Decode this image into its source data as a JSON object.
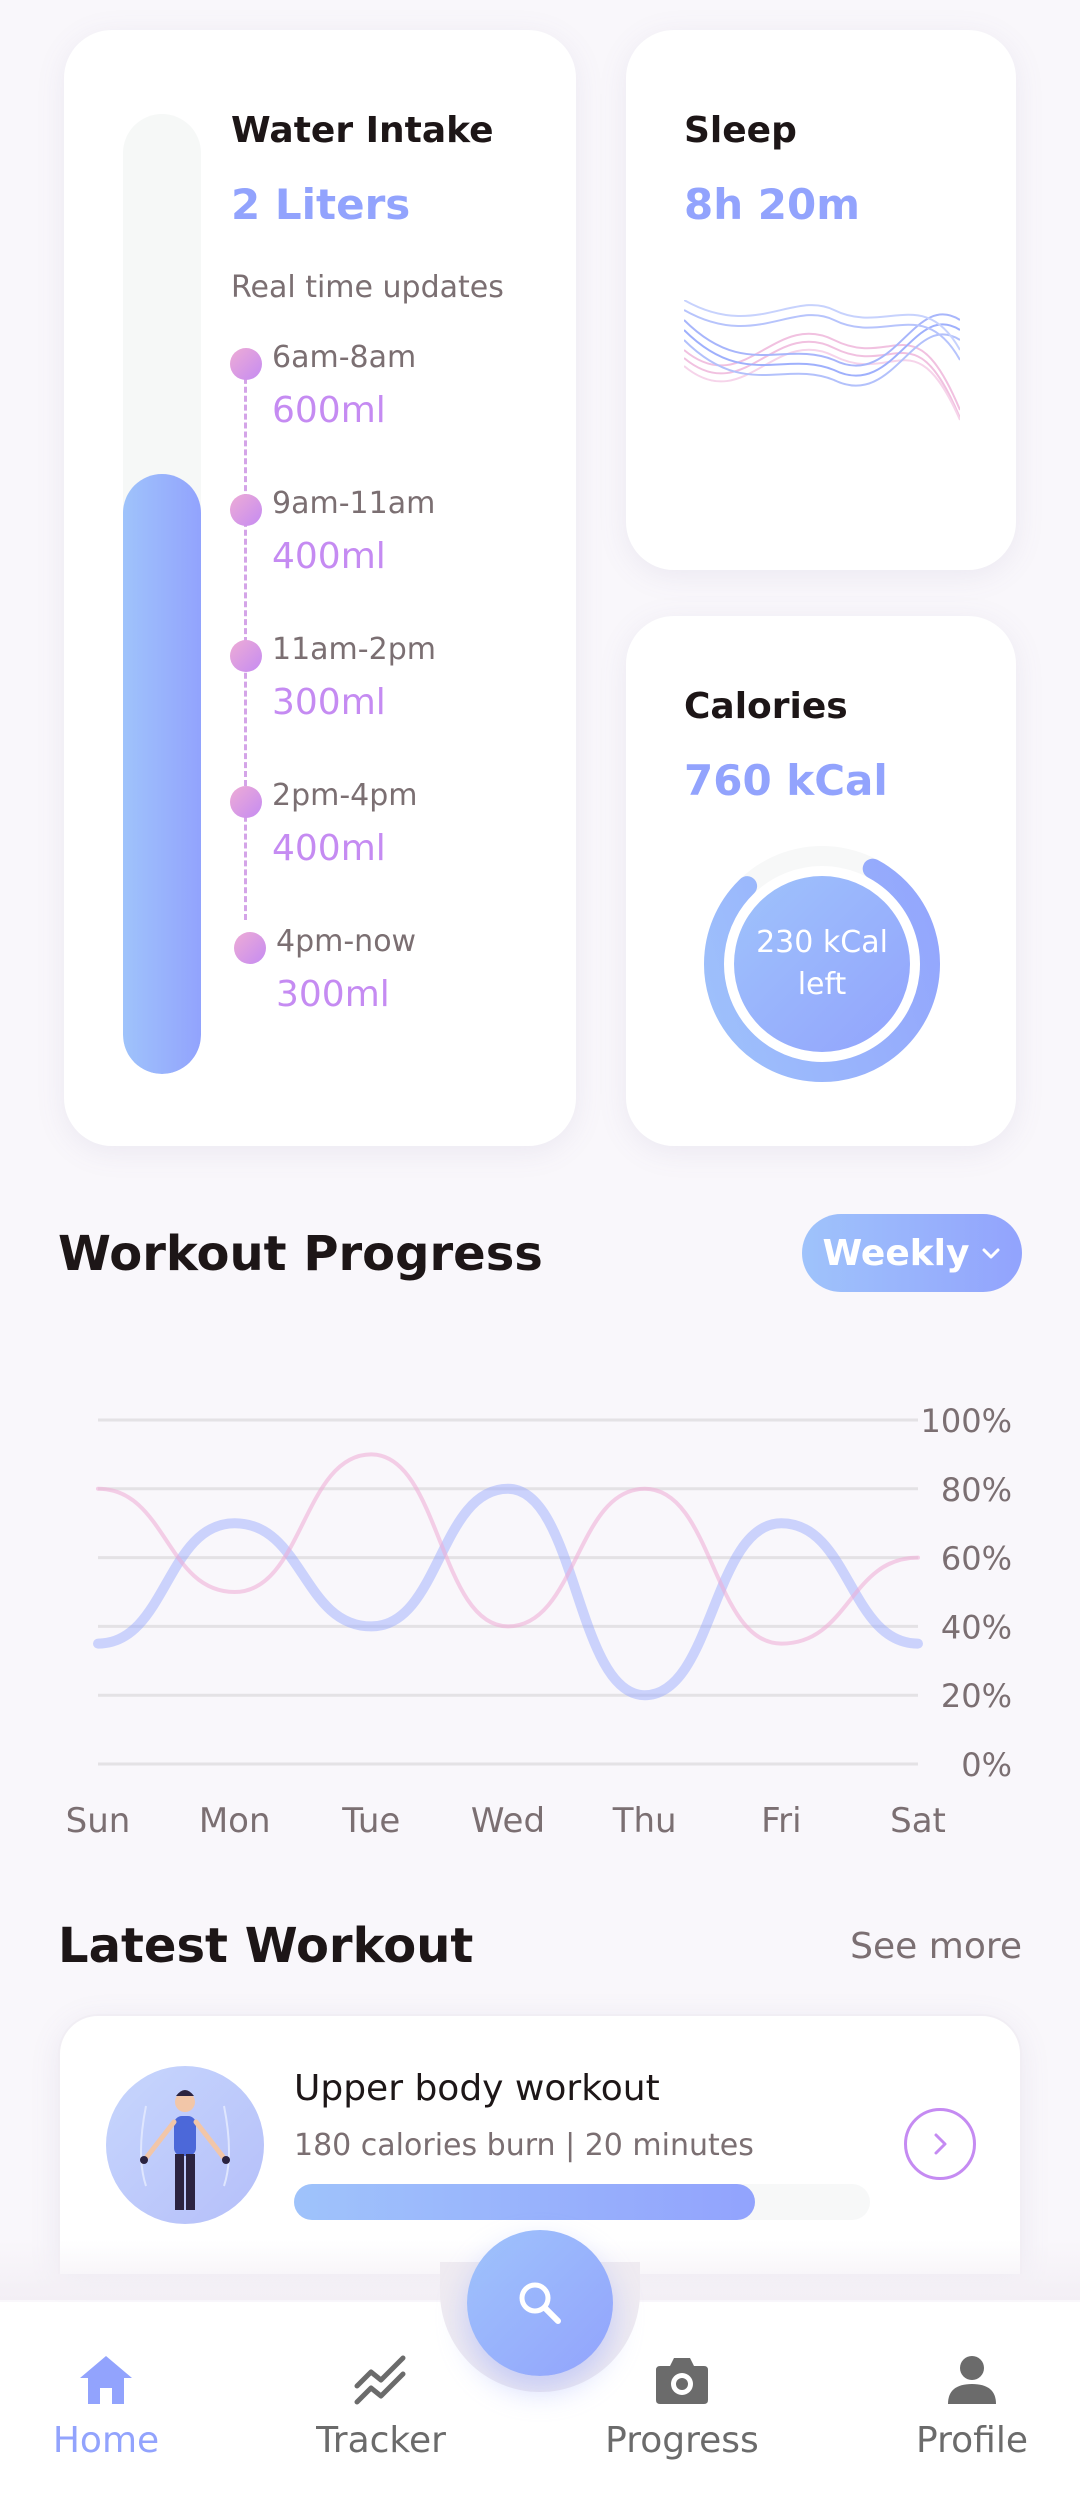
{
  "water": {
    "title": "Water Intake",
    "value": "2 Liters",
    "subtitle": "Real time updates",
    "fill_fraction": 0.625,
    "timeline": [
      {
        "time": "6am-8am",
        "amount": "600ml"
      },
      {
        "time": "9am-11am",
        "amount": "400ml"
      },
      {
        "time": "11am-2pm",
        "amount": "300ml"
      },
      {
        "time": "2pm-4pm",
        "amount": "400ml"
      },
      {
        "time": "4pm-now",
        "amount": "300ml"
      }
    ]
  },
  "sleep": {
    "title": "Sleep",
    "value": "8h 20m"
  },
  "calories": {
    "title": "Calories",
    "value": "760 kCal",
    "left_text": "230 kCal left",
    "progress_fraction": 0.8
  },
  "workout_progress": {
    "title": "Workout Progress",
    "period_button": "Weekly"
  },
  "chart_data": {
    "type": "line",
    "categories": [
      "Sun",
      "Mon",
      "Tue",
      "Wed",
      "Thu",
      "Fri",
      "Sat"
    ],
    "y_ticks": [
      "100%",
      "80%",
      "60%",
      "40%",
      "20%",
      "0%"
    ],
    "ylim": [
      0,
      100
    ],
    "series": [
      {
        "color": "#92a3fd",
        "values": [
          35,
          70,
          40,
          80,
          20,
          70,
          35
        ]
      },
      {
        "color": "#eeacd5",
        "values": [
          80,
          50,
          90,
          40,
          80,
          35,
          60
        ]
      }
    ]
  },
  "latest_workout": {
    "title": "Latest Workout",
    "see_more": "See more",
    "item": {
      "name": "Upper body workout",
      "meta": "180 calories burn | 20 minutes",
      "progress_fraction": 0.8
    }
  },
  "nav": {
    "items": [
      {
        "label": "Home",
        "icon": "home-icon"
      },
      {
        "label": "Tracker",
        "icon": "activity-icon"
      },
      {
        "label": "Progress",
        "icon": "camera-icon"
      },
      {
        "label": "Profile",
        "icon": "profile-icon"
      }
    ],
    "active": "Home",
    "fab_icon": "search-icon"
  },
  "colors": {
    "brand_blue": "#92a3fd",
    "brand_purple": "#c58bf2",
    "brand_pink": "#eeacd5"
  }
}
